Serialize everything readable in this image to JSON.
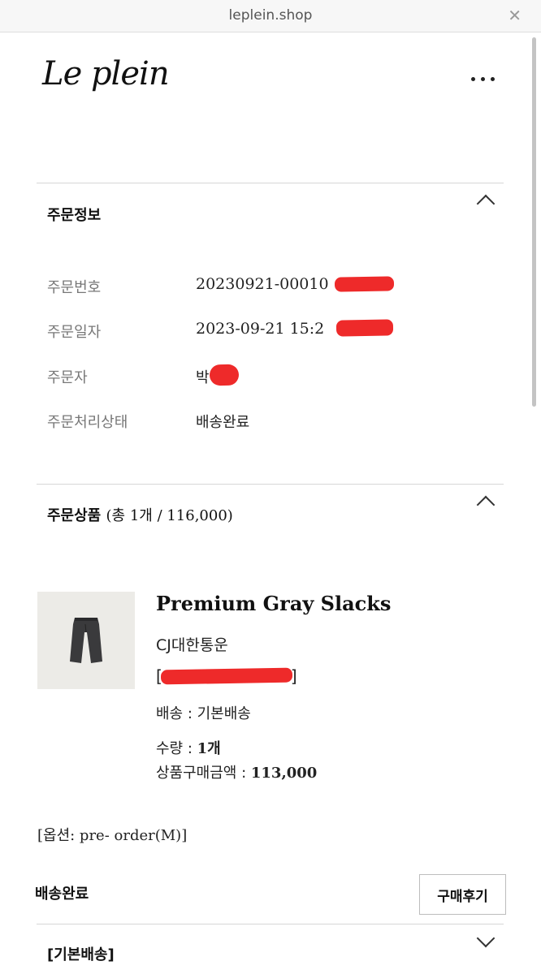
{
  "browser": {
    "url": "leplein.shop",
    "close_glyph": "✕"
  },
  "header": {
    "logo_text": "Le plein",
    "more_glyph": "..."
  },
  "order_info": {
    "title": "주문정보",
    "rows": [
      {
        "label": "주문번호",
        "value": "20230921-00010"
      },
      {
        "label": "주문일자",
        "value": "2023-09-21 15:2"
      },
      {
        "label": "주문자",
        "value": "박"
      },
      {
        "label": "주문처리상태",
        "value": "배송완료"
      }
    ]
  },
  "order_items": {
    "title": "주문상품",
    "summary": "(총 1개 / 116,000)",
    "product": {
      "name": "Premium Gray Slacks",
      "courier": "CJ대한통운",
      "tracking_open": "[",
      "tracking_close": "]",
      "shipping_label": "배송 : 기본배송",
      "qty_label": "수량 : ",
      "qty_value": "1개",
      "price_label": "상품구매금액 : ",
      "price_value": "113,000"
    },
    "option": "[옵션: pre- order(M)]",
    "status": "배송완료",
    "review_button": "구매후기"
  },
  "shipping_section": {
    "title": "[기본배송]"
  }
}
